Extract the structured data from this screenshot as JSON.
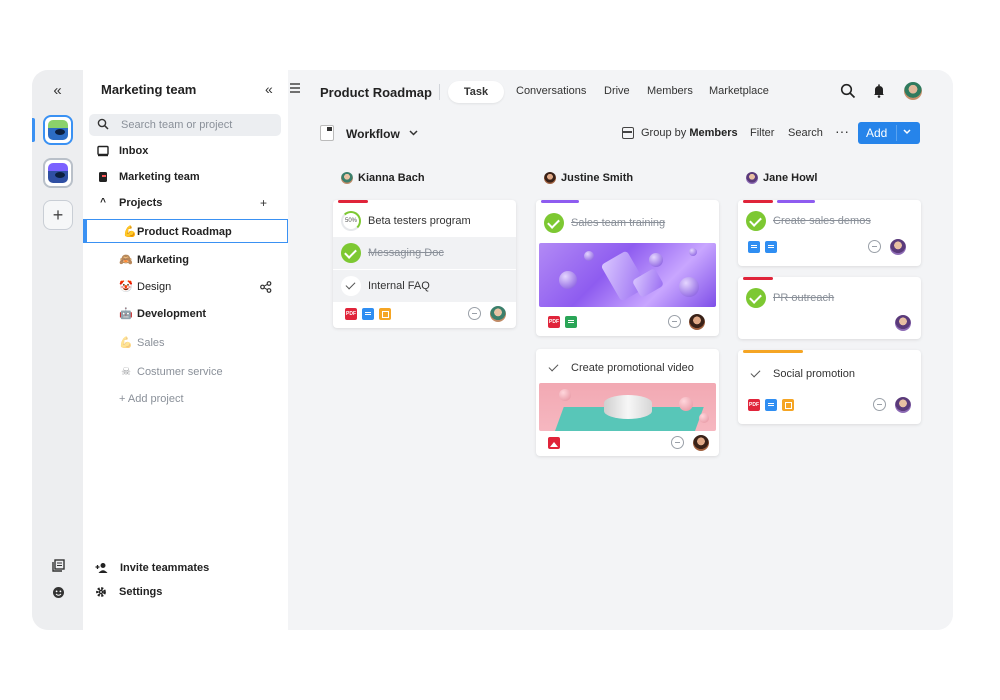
{
  "rail": {
    "collapse_glyph": "«",
    "add_glyph": "+"
  },
  "sidebar": {
    "title": "Marketing team",
    "collapse_glyph": "«",
    "search_placeholder": "Search team or project",
    "inbox": "Inbox",
    "team": "Marketing team",
    "projects_label": "Projects",
    "projects_toggle": "^",
    "projects_add": "+",
    "projects": [
      {
        "label": "Product Roadmap",
        "emoji": "💪",
        "style": "sel"
      },
      {
        "label": "Marketing",
        "emoji": "🙈",
        "style": "bold"
      },
      {
        "label": "Design",
        "emoji": "🤡",
        "style": "normal"
      },
      {
        "label": "Development",
        "emoji": "🤖",
        "style": "bold"
      },
      {
        "label": "Sales",
        "emoji": "💪",
        "style": "muted"
      },
      {
        "label": "Costumer service",
        "emoji": "☠",
        "style": "muted"
      }
    ],
    "add_project": "+  Add project",
    "invite": "Invite teammates",
    "settings": "Settings"
  },
  "topbar": {
    "title": "Product Roadmap",
    "tabs": [
      "Task",
      "Conversations",
      "Drive",
      "Members",
      "Marketplace"
    ],
    "active_tab": "Task"
  },
  "toolbar": {
    "view": "Workflow",
    "group_by": "Group by",
    "group_by_value": "Members",
    "filter": "Filter",
    "search": "Search",
    "more": "···",
    "add": "Add"
  },
  "columns": [
    {
      "name": "Kianna Bach",
      "cards": [
        {
          "tag_color": "#e0243a",
          "tasks": [
            {
              "text": "Beta testers program",
              "state": "progress",
              "progress": "50%"
            },
            {
              "text": "Messaging Doc",
              "state": "done"
            },
            {
              "text": "Internal FAQ",
              "state": "open"
            }
          ],
          "files": [
            "pdf",
            "doc",
            "slide"
          ]
        }
      ]
    },
    {
      "name": "Justine Smith",
      "cards": [
        {
          "tag_color": "#8e5cf0",
          "tasks": [
            {
              "text": "Sales team training",
              "state": "done"
            }
          ],
          "image": "purple",
          "files": [
            "pdf",
            "sheet"
          ]
        },
        {
          "tag_color": "",
          "tasks": [
            {
              "text": "Create promotional video",
              "state": "open"
            }
          ],
          "image": "pink",
          "files": [
            "img"
          ]
        }
      ]
    },
    {
      "name": "Jane Howl",
      "cards": [
        {
          "tag_color": "#e0243a",
          "tag_color2": "#8e5cf0",
          "tasks": [
            {
              "text": "Create sales demos",
              "state": "done"
            }
          ],
          "files": [
            "doc",
            "doc"
          ]
        },
        {
          "tag_color": "#e0243a",
          "tasks": [
            {
              "text": "PR outreach",
              "state": "done"
            }
          ],
          "files": []
        },
        {
          "tag_color": "#f5a524",
          "tasks": [
            {
              "text": "Social promotion",
              "state": "open"
            }
          ],
          "files": [
            "pdf",
            "doc",
            "slide"
          ]
        }
      ]
    }
  ],
  "file_labels": {
    "pdf": "PDF"
  },
  "colors": {
    "accent": "#2684ea",
    "done_green": "#7dc832",
    "background": "#f3f4f6"
  }
}
